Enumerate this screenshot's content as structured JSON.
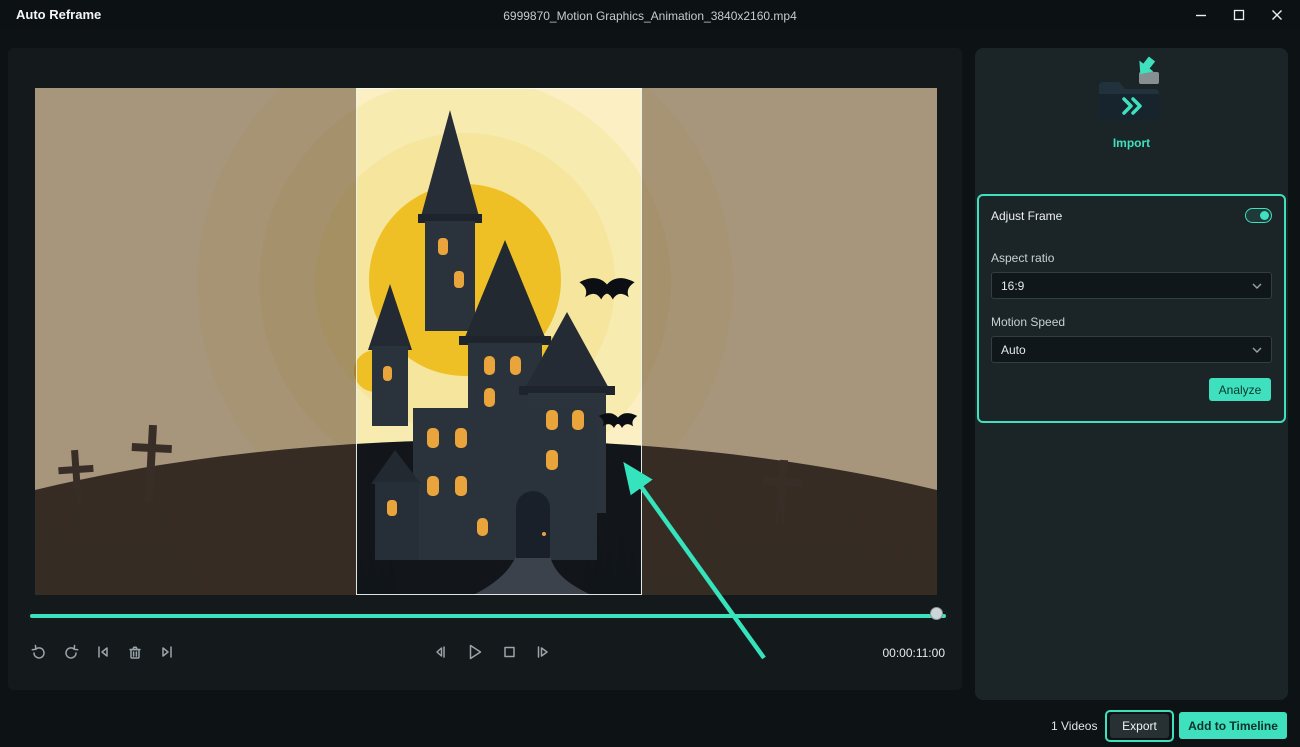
{
  "window": {
    "app_title": "Auto Reframe",
    "document_title": "6999870_Motion Graphics_Animation_3840x2160.mp4"
  },
  "preview": {
    "timestamp": "00:00:11:00"
  },
  "sidebar": {
    "import_label": "Import",
    "adjust_frame": {
      "title": "Adjust Frame",
      "toggle_on": true,
      "aspect_ratio_label": "Aspect ratio",
      "aspect_ratio_value": "16:9",
      "motion_speed_label": "Motion Speed",
      "motion_speed_value": "Auto",
      "analyze_label": "Analyze"
    }
  },
  "footer": {
    "videos_count": "1 Videos",
    "export_label": "Export",
    "add_to_timeline_label": "Add to Timeline"
  },
  "colors": {
    "accent": "#3ee0bd"
  }
}
